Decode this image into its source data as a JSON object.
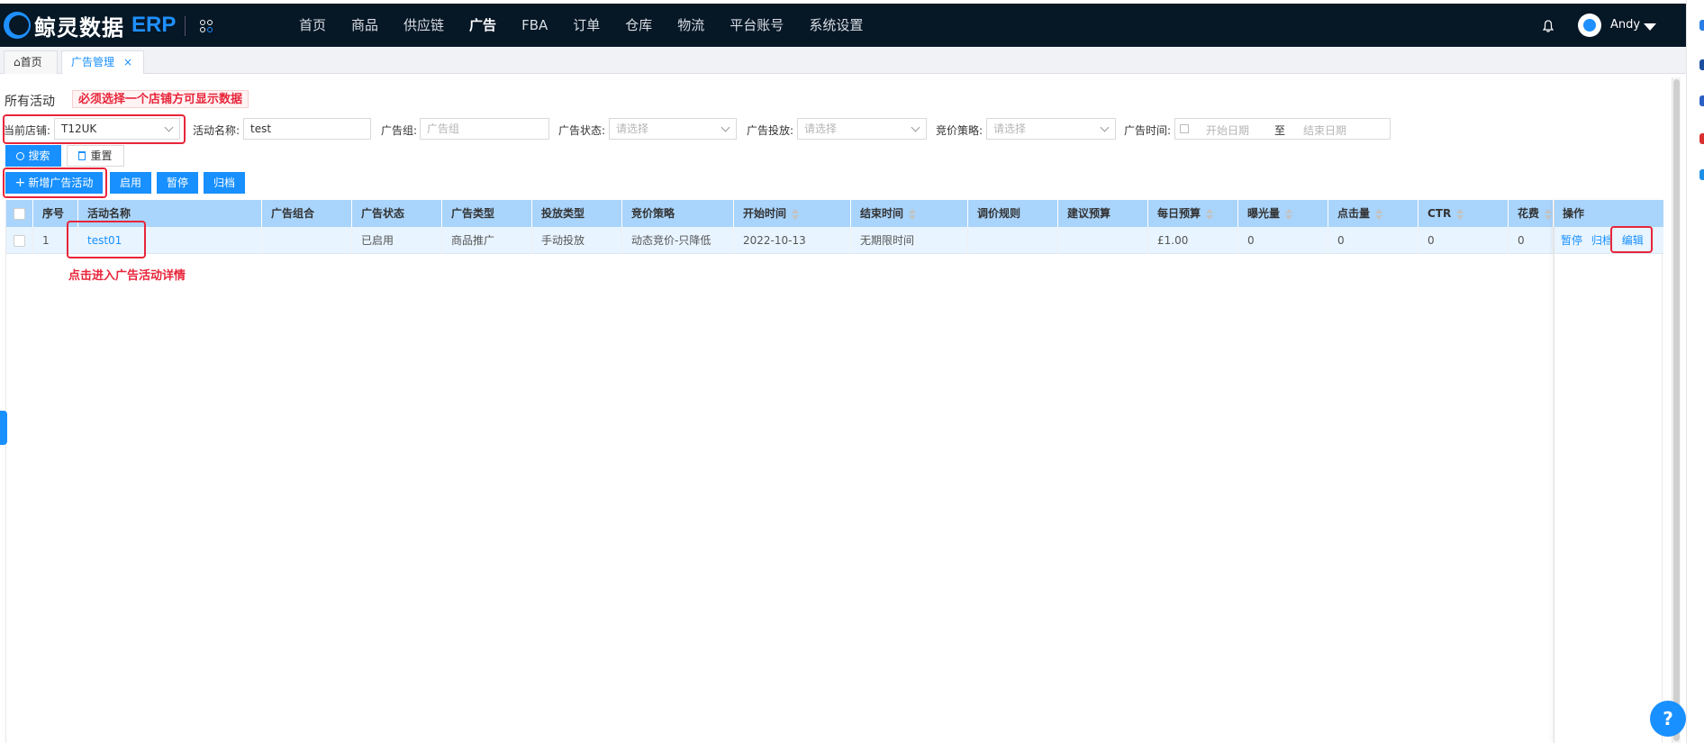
{
  "brand": {
    "name": "鲸灵数据",
    "suffix": "ERP"
  },
  "nav": {
    "items": [
      "首页",
      "商品",
      "供应链",
      "广告",
      "FBA",
      "订单",
      "仓库",
      "物流",
      "平台账号",
      "系统设置"
    ],
    "active": "广告"
  },
  "user": {
    "name": "Andy"
  },
  "tabs": {
    "home": "首页",
    "active": "广告管理",
    "close": "×"
  },
  "page": {
    "title": "所有活动",
    "notice": "必须选择一个店铺方可显示数据"
  },
  "filters": {
    "store_label": "当前店铺:",
    "store_value": "T12UK",
    "name_label": "活动名称:",
    "name_value": "test",
    "group_label": "广告组:",
    "group_placeholder": "广告组",
    "status_label": "广告状态:",
    "status_placeholder": "请选择",
    "delivery_label": "广告投放:",
    "delivery_placeholder": "请选择",
    "bid_label": "竞价策略:",
    "bid_placeholder": "请选择",
    "time_label": "广告时间:",
    "date_start": "开始日期",
    "date_sep": "至",
    "date_end": "结束日期"
  },
  "buttons": {
    "search": "搜索",
    "reset": "重置",
    "add": "新增广告活动",
    "enable": "启用",
    "pause": "暂停",
    "archive": "归档"
  },
  "table": {
    "headers": [
      "序号",
      "活动名称",
      "广告组合",
      "广告状态",
      "广告类型",
      "投放类型",
      "竞价策略",
      "开始时间",
      "结束时间",
      "调价规则",
      "建议预算",
      "每日预算",
      "曝光量",
      "点击量",
      "CTR",
      "花费",
      "操作"
    ],
    "rows": [
      {
        "index": "1",
        "name": "test01",
        "portfolio": "",
        "status": "已启用",
        "ad_type": "商品推广",
        "delivery_type": "手动投放",
        "bid_strategy": "动态竞价-只降低",
        "start": "2022-10-13",
        "end": "无期限时间",
        "rule": "",
        "suggested_budget": "",
        "daily_budget": "£1.00",
        "impressions": "0",
        "clicks": "0",
        "ctr": "0",
        "spend": "0",
        "ops": [
          "暂停",
          "归档",
          "编辑"
        ]
      }
    ]
  },
  "annotation": "点击进入广告活动详情",
  "colors": {
    "accent": "#1890ff",
    "nav_bg": "#061726",
    "header_bg": "#a9d4fb",
    "annotation": "#e8253a"
  }
}
